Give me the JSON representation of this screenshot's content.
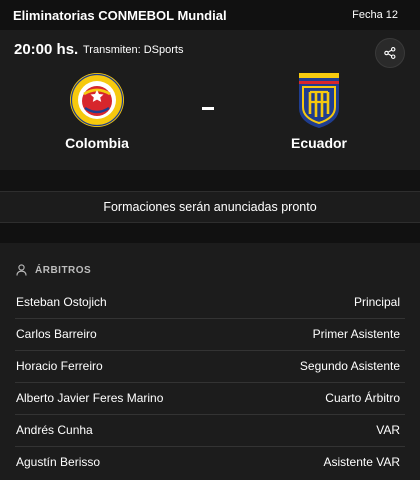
{
  "header": {
    "title": "Eliminatorias CONMEBOL Mundial",
    "round": "Fecha 12"
  },
  "match": {
    "time": "20:00 hs.",
    "broadcast": "Transmiten: DSports",
    "share_icon": "share-icon",
    "separator": "-",
    "home": {
      "name": "Colombia",
      "crest": "colombia-crest-icon"
    },
    "away": {
      "name": "Ecuador",
      "crest": "ecuador-crest-icon"
    }
  },
  "lineups": {
    "note": "Formaciones serán anunciadas pronto"
  },
  "referees": {
    "label": "ÁRBITROS",
    "icon": "person-icon",
    "rows": [
      {
        "name": "Esteban Ostojich",
        "role": "Principal"
      },
      {
        "name": "Carlos Barreiro",
        "role": "Primer Asistente"
      },
      {
        "name": "Horacio Ferreiro",
        "role": "Segundo Asistente"
      },
      {
        "name": "Alberto Javier Feres Marino",
        "role": "Cuarto Árbitro"
      },
      {
        "name": "Andrés Cunha",
        "role": "VAR"
      },
      {
        "name": "Agustín Berisso",
        "role": "Asistente VAR"
      }
    ]
  },
  "colors": {
    "background": "#111111",
    "card": "#1c1c1c",
    "text": "#ffffff",
    "muted": "#bdbdbd",
    "colombia_yellow": "#f6c90e",
    "colombia_red": "#d7262c",
    "ecuador_blue": "#1f3d8f",
    "ecuador_yellow": "#f6c90e"
  }
}
